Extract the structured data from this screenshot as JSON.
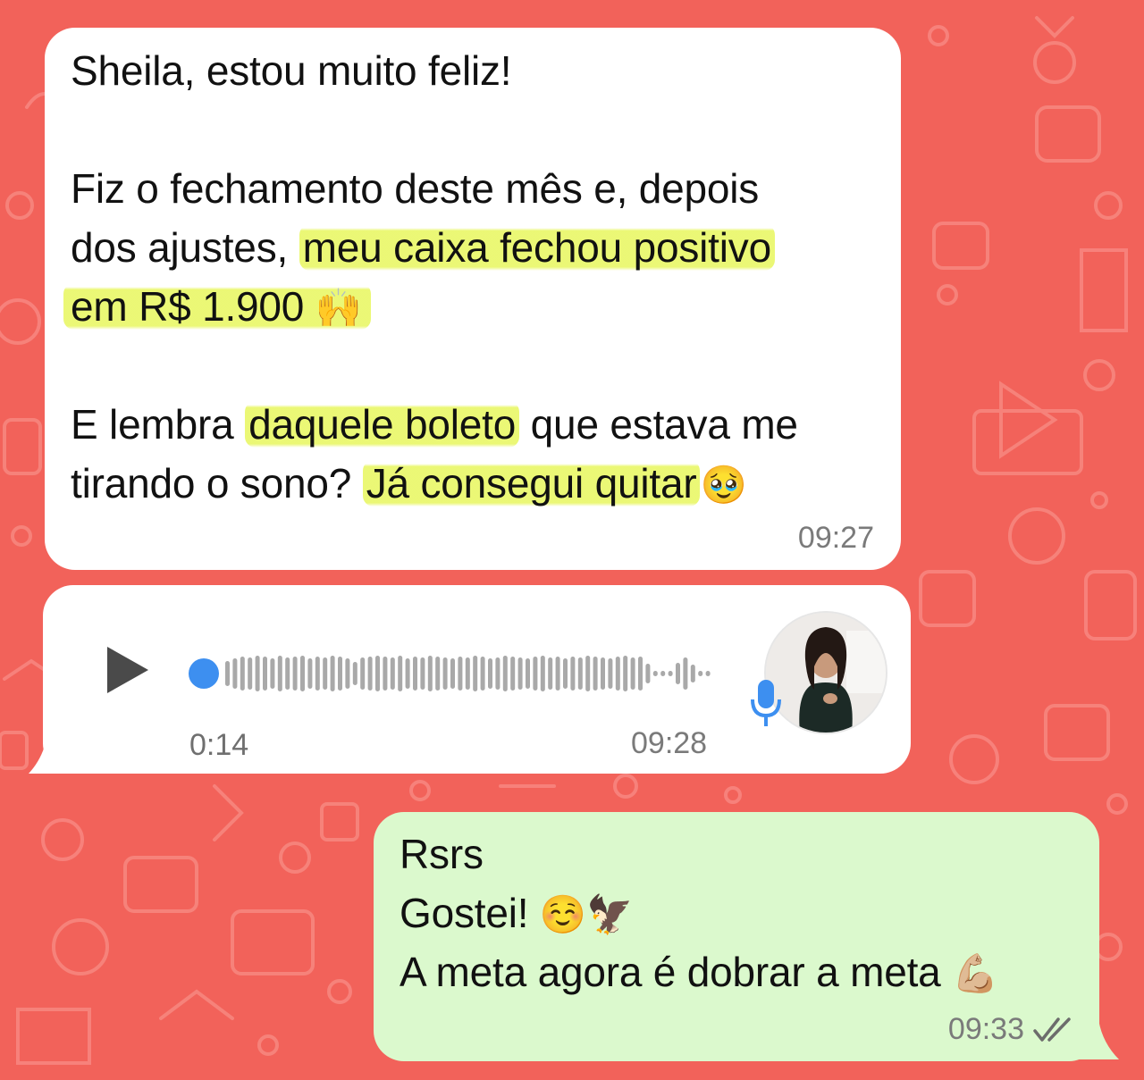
{
  "chat": {
    "incoming_text": {
      "line1": "Sheila, estou muito feliz!",
      "line2": "Fiz o fechamento deste mês e, depois",
      "line3_plain": "dos ajustes, ",
      "line3_hl": "meu caixa fechou positivo",
      "line4_hl": "em R$ 1.900",
      "line4_emoji": "🙌",
      "line5_plain1": "E lembra ",
      "line5_hl": "daquele boleto",
      "line5_plain2": " que estava me",
      "line6_plain": "tirando o sono? ",
      "line6_hl": "Já consegui quitar",
      "line6_emoji": "🥹",
      "time": "09:27"
    },
    "voice_message": {
      "duration": "0:14",
      "time": "09:28",
      "progress": 0,
      "icons": [
        "play-icon",
        "microphone-icon"
      ]
    },
    "outgoing_text": {
      "line1": "Rsrs",
      "line2": "Gostei! ",
      "line2_emoji": "☺️🦅",
      "line3": "A meta agora é dobrar a meta ",
      "line3_emoji": "💪🏼",
      "time": "09:33",
      "status_icon": "double-check-icon"
    },
    "colors": {
      "wallpaper": "#f2625a",
      "incoming_bubble": "#ffffff",
      "outgoing_bubble": "#dbf9cd",
      "highlight": "#eaf76e",
      "voice_dot": "#3d8ff0"
    }
  }
}
